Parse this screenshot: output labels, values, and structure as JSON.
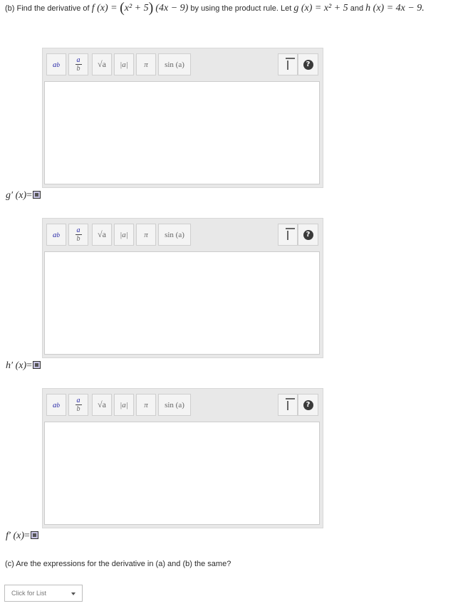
{
  "question_b": {
    "lead": "(b) Find the derivative of",
    "f_def": "f (x) = ",
    "factor1": "x² + 5",
    "factor2": "(4x − 9)",
    "mid": "by using the product rule. Let",
    "g_def": "g (x) = x² + 5",
    "and": "and",
    "h_def": "h (x) = 4x − 9."
  },
  "toolbar": {
    "buttons": [
      {
        "name": "superscript",
        "symbol": "a",
        "symbol_sup": "b"
      },
      {
        "name": "fraction",
        "num": "a",
        "den": "b"
      },
      {
        "name": "sqrt",
        "symbol": "√a"
      },
      {
        "name": "abs",
        "symbol": "|a|"
      },
      {
        "name": "pi",
        "symbol": "π"
      },
      {
        "name": "sin",
        "symbol": "sin (a)"
      }
    ],
    "help_symbol": "?"
  },
  "answers": [
    {
      "label": "g′ (x)",
      "eq": "="
    },
    {
      "label": "h′ (x)",
      "eq": "="
    },
    {
      "label": "f′ (x)",
      "eq": "="
    }
  ],
  "question_c": {
    "text": "(c) Are the expressions for the derivative in (a) and (b) the same?"
  },
  "dropdown": {
    "placeholder": "Click for List"
  }
}
